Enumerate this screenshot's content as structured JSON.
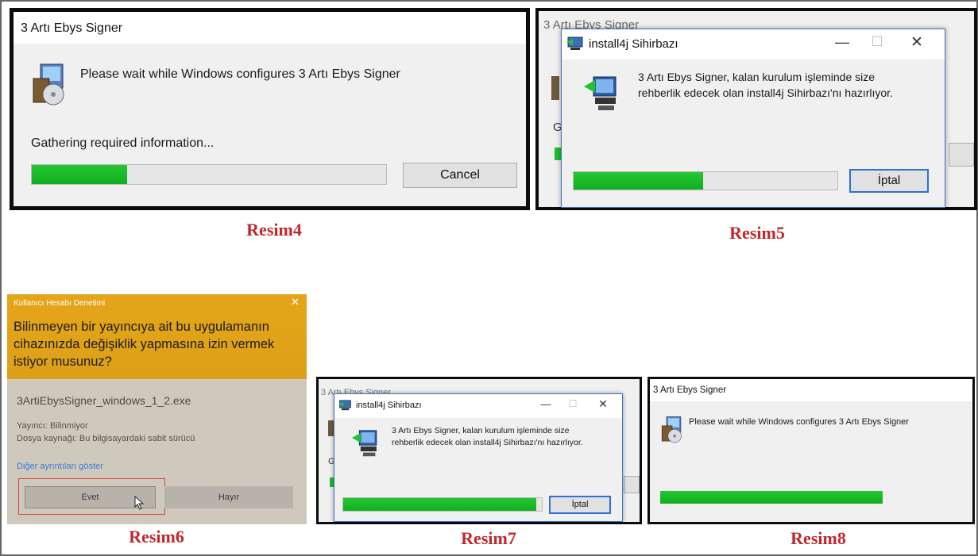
{
  "captions": {
    "r4": "Resim4",
    "r5": "Resim5",
    "r6": "Resim6",
    "r7": "Resim7",
    "r8": "Resim8"
  },
  "r4": {
    "title": "3 Artı Ebys Signer",
    "message": "Please wait while Windows configures 3 Artı Ebys Signer",
    "status": "Gathering required information...",
    "cancel": "Cancel",
    "progress": 0.27
  },
  "r5": {
    "bg_title": "3 Artı Ebys Signer",
    "bg_letter": "G",
    "title": "install4j Sihirbazı",
    "message_line1": "3 Artı Ebys Signer, kalan kurulum işleminde size",
    "message_line2": "rehberlik edecek olan install4j Sihirbazı'nı hazırlıyor.",
    "cancel": "İptal",
    "minimize": "—",
    "maximize": "☐",
    "close": "✕",
    "progress": 0.49
  },
  "r6": {
    "header": "Kullanıcı Hesabı Denetimi",
    "close": "✕",
    "question": "Bilinmeyen bir yayıncıya ait bu uygulamanın cihazınızda değişiklik yapmasına izin vermek istiyor musunuz?",
    "filename": "3ArtiEbysSigner_windows_1_2.exe",
    "publisher": "Yayıncı: Bilinmiyor",
    "source": "Dosya kaynağı: Bu bilgisayardaki sabit sürücü",
    "details_link": "Diğer ayrıntıları göster",
    "yes": "Evet",
    "no": "Hayır",
    "colors": {
      "header": "#e3a51b",
      "body": "#cfc9bd",
      "link": "#3a7bd5"
    }
  },
  "r7": {
    "bg_title": "3 Artı Ebys Signer",
    "bg_letter": "G",
    "title": "install4j Sihirbazı",
    "message_line1": "3 Artı Ebys Signer, kalan kurulum işleminde size",
    "message_line2": "rehberlik edecek olan install4j Sihirbazı'nı hazırlıyor.",
    "cancel": "İptal",
    "minimize": "—",
    "maximize": "☐",
    "close": "✕",
    "progress": 0.97
  },
  "r8": {
    "title": "3 Artı Ebys Signer",
    "message": "Please wait while Windows configures 3 Artı Ebys Signer",
    "progress": 1.0
  },
  "colors": {
    "accent": "#c0282c",
    "progress": "#1cbd2b",
    "frame": "#0a0a0a"
  }
}
